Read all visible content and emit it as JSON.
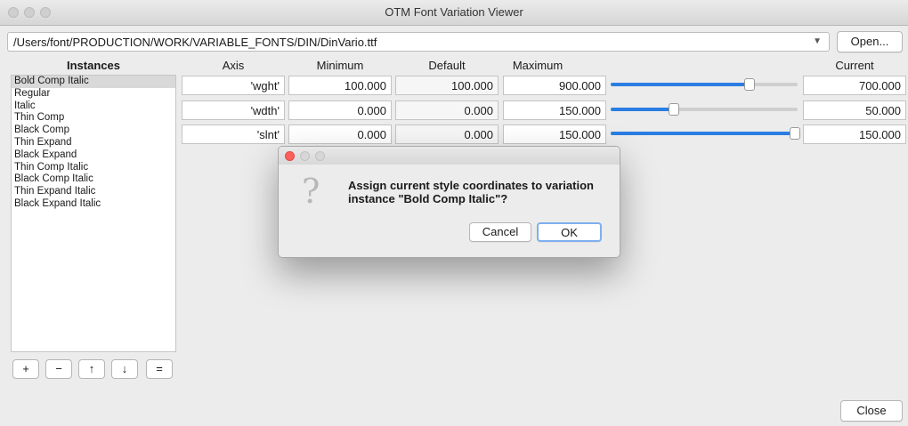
{
  "window": {
    "title": "OTM Font Variation Viewer"
  },
  "file": {
    "path": "/Users/font/PRODUCTION/WORK/VARIABLE_FONTS/DIN/DinVario.ttf",
    "open_label": "Open..."
  },
  "instances": {
    "header": "Instances",
    "items": [
      "Bold Comp Italic",
      "Regular",
      "Italic",
      "Thin Comp",
      "Black Comp",
      "Thin Expand",
      "Black Expand",
      "Thin Comp Italic",
      "Black Comp Italic",
      "Thin Expand Italic",
      "Black Expand Italic"
    ],
    "selected_index": 0,
    "buttons": [
      "+",
      "−",
      "↑",
      "↓",
      "="
    ]
  },
  "columns": {
    "axis": "Axis",
    "minimum": "Minimum",
    "default": "Default",
    "maximum": "Maximum",
    "current": "Current"
  },
  "axes": [
    {
      "tag": "'wght'",
      "minimum": "100.000",
      "default": "100.000",
      "maximum": "900.000",
      "current": "700.000",
      "slider_fraction": 0.75
    },
    {
      "tag": "'wdth'",
      "minimum": "0.000",
      "default": "0.000",
      "maximum": "150.000",
      "current": "50.000",
      "slider_fraction": 0.333
    },
    {
      "tag": "'slnt'",
      "minimum": "0.000",
      "default": "0.000",
      "maximum": "150.000",
      "current": "150.000",
      "slider_fraction": 1.0
    }
  ],
  "dialog": {
    "message": "Assign current style coordinates to variation instance \"Bold Comp Italic\"?",
    "cancel_label": "Cancel",
    "ok_label": "OK"
  },
  "footer": {
    "close_label": "Close"
  },
  "colors": {
    "accent": "#2a7de1",
    "close_dot": "#fc605c"
  }
}
